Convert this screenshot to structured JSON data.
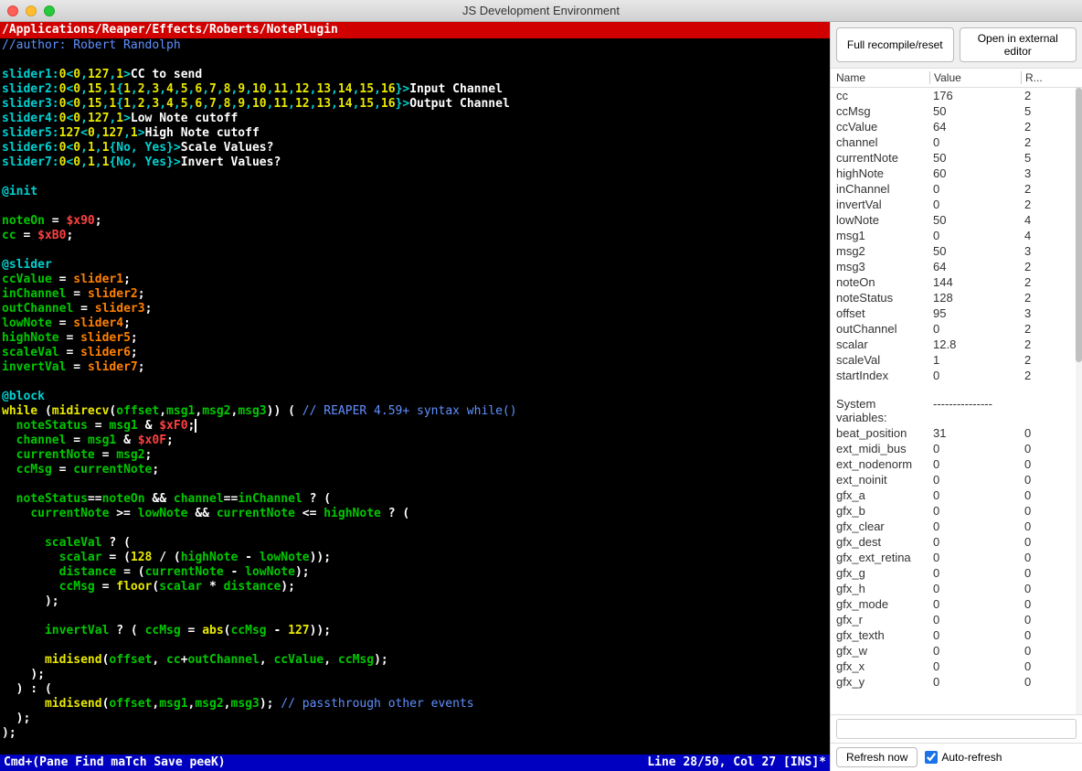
{
  "window": {
    "title": "JS Development Environment"
  },
  "editor": {
    "path": "/Applications/Reaper/Effects/Roberts/NotePlugin",
    "author_comment": "//author: Robert Randolph",
    "sliders": {
      "s1": {
        "def": "slider1:0<0,127,1>",
        "label": "CC to send"
      },
      "s2": {
        "def": "slider2:0<0,15,1{1,2,3,4,5,6,7,8,9,10,11,12,13,14,15,16}>",
        "label": "Input Channel"
      },
      "s3": {
        "def": "slider3:0<0,15,1{1,2,3,4,5,6,7,8,9,10,11,12,13,14,15,16}>",
        "label": "Output Channel"
      },
      "s4": {
        "def": "slider4:0<0,127,1>",
        "label": "Low Note cutoff"
      },
      "s5": {
        "def": "slider5:127<0,127,1>",
        "label": "High Note cutoff"
      },
      "s6": {
        "def": "slider6:0<0,1,1{No, Yes}>",
        "label": "Scale Values?"
      },
      "s7": {
        "def": "slider7:0<0,1,1{No, Yes}>",
        "label": "Invert Values?"
      }
    },
    "sections": {
      "init": "@init",
      "slider": "@slider",
      "block": "@block"
    },
    "lines": {
      "noteOn": "noteOn = $x90;",
      "cc": "cc = $xB0;",
      "ccValue": "ccValue = slider1;",
      "inChannel": "inChannel = slider2;",
      "outChannel": "outChannel = slider3;",
      "lowNote": "lowNote = slider4;",
      "highNote": "highNote = slider5;",
      "scaleVal": "scaleVal = slider6;",
      "invertVal": "invertVal = slider7;",
      "while": "while (midirecv(offset,msg1,msg2,msg3)) (",
      "while_comment": "// REAPER 4.59+ syntax while()",
      "noteStatus": "noteStatus = msg1 & $xF0;",
      "channel": "channel = msg1 & $x0F;",
      "currentNote": "currentNote = msg2;",
      "ccMsg": "ccMsg = currentNote;",
      "cond1": "noteStatus==noteOn && channel==inChannel ? (",
      "cond2": "currentNote >= lowNote && currentNote <= highNote ? (",
      "scaleValQ": "scaleVal ? (",
      "scalar": "scalar = (128 / (highNote - lowNote));",
      "distance": "distance = (currentNote - lowNote);",
      "ccMsgFloor": "ccMsg = floor(scalar * distance);",
      "invertQ": "invertVal ? ( ccMsg = abs(ccMsg - 127));",
      "midisend1": "midisend(offset, cc+outChannel, ccValue, ccMsg);",
      "else": ") : (",
      "midisend2": "midisend(offset,msg1,msg2,msg3);",
      "passthrough_comment": "// passthrough other events"
    },
    "status_left": "Cmd+(Pane Find maTch Save peeK)",
    "status_right": "Line 28/50, Col 27 [INS]*"
  },
  "toolbar": {
    "recompile": "Full recompile/reset",
    "open_external": "Open in external editor"
  },
  "vartable": {
    "headers": {
      "name": "Name",
      "value": "Value",
      "refs": "R..."
    },
    "vars": [
      {
        "name": "cc",
        "value": "176",
        "refs": "2"
      },
      {
        "name": "ccMsg",
        "value": "50",
        "refs": "5"
      },
      {
        "name": "ccValue",
        "value": "64",
        "refs": "2"
      },
      {
        "name": "channel",
        "value": "0",
        "refs": "2"
      },
      {
        "name": "currentNote",
        "value": "50",
        "refs": "5"
      },
      {
        "name": "highNote",
        "value": "60",
        "refs": "3"
      },
      {
        "name": "inChannel",
        "value": "0",
        "refs": "2"
      },
      {
        "name": "invertVal",
        "value": "0",
        "refs": "2"
      },
      {
        "name": "lowNote",
        "value": "50",
        "refs": "4"
      },
      {
        "name": "msg1",
        "value": "0",
        "refs": "4"
      },
      {
        "name": "msg2",
        "value": "50",
        "refs": "3"
      },
      {
        "name": "msg3",
        "value": "64",
        "refs": "2"
      },
      {
        "name": "noteOn",
        "value": "144",
        "refs": "2"
      },
      {
        "name": "noteStatus",
        "value": "128",
        "refs": "2"
      },
      {
        "name": "offset",
        "value": "95",
        "refs": "3"
      },
      {
        "name": "outChannel",
        "value": "0",
        "refs": "2"
      },
      {
        "name": "scalar",
        "value": "12.8",
        "refs": "2"
      },
      {
        "name": "scaleVal",
        "value": "1",
        "refs": "2"
      },
      {
        "name": "startIndex",
        "value": "0",
        "refs": "2"
      }
    ],
    "sysvars_label": "System variables:",
    "sysvars_dashes": "---------------",
    "sysvars": [
      {
        "name": "beat_position",
        "value": "31",
        "refs": "0"
      },
      {
        "name": "ext_midi_bus",
        "value": "0",
        "refs": "0"
      },
      {
        "name": "ext_nodenorm",
        "value": "0",
        "refs": "0"
      },
      {
        "name": "ext_noinit",
        "value": "0",
        "refs": "0"
      },
      {
        "name": "gfx_a",
        "value": "0",
        "refs": "0"
      },
      {
        "name": "gfx_b",
        "value": "0",
        "refs": "0"
      },
      {
        "name": "gfx_clear",
        "value": "0",
        "refs": "0"
      },
      {
        "name": "gfx_dest",
        "value": "0",
        "refs": "0"
      },
      {
        "name": "gfx_ext_retina",
        "value": "0",
        "refs": "0"
      },
      {
        "name": "gfx_g",
        "value": "0",
        "refs": "0"
      },
      {
        "name": "gfx_h",
        "value": "0",
        "refs": "0"
      },
      {
        "name": "gfx_mode",
        "value": "0",
        "refs": "0"
      },
      {
        "name": "gfx_r",
        "value": "0",
        "refs": "0"
      },
      {
        "name": "gfx_texth",
        "value": "0",
        "refs": "0"
      },
      {
        "name": "gfx_w",
        "value": "0",
        "refs": "0"
      },
      {
        "name": "gfx_x",
        "value": "0",
        "refs": "0"
      },
      {
        "name": "gfx_y",
        "value": "0",
        "refs": "0"
      }
    ]
  },
  "bottom": {
    "refresh": "Refresh now",
    "autorefresh": "Auto-refresh"
  }
}
